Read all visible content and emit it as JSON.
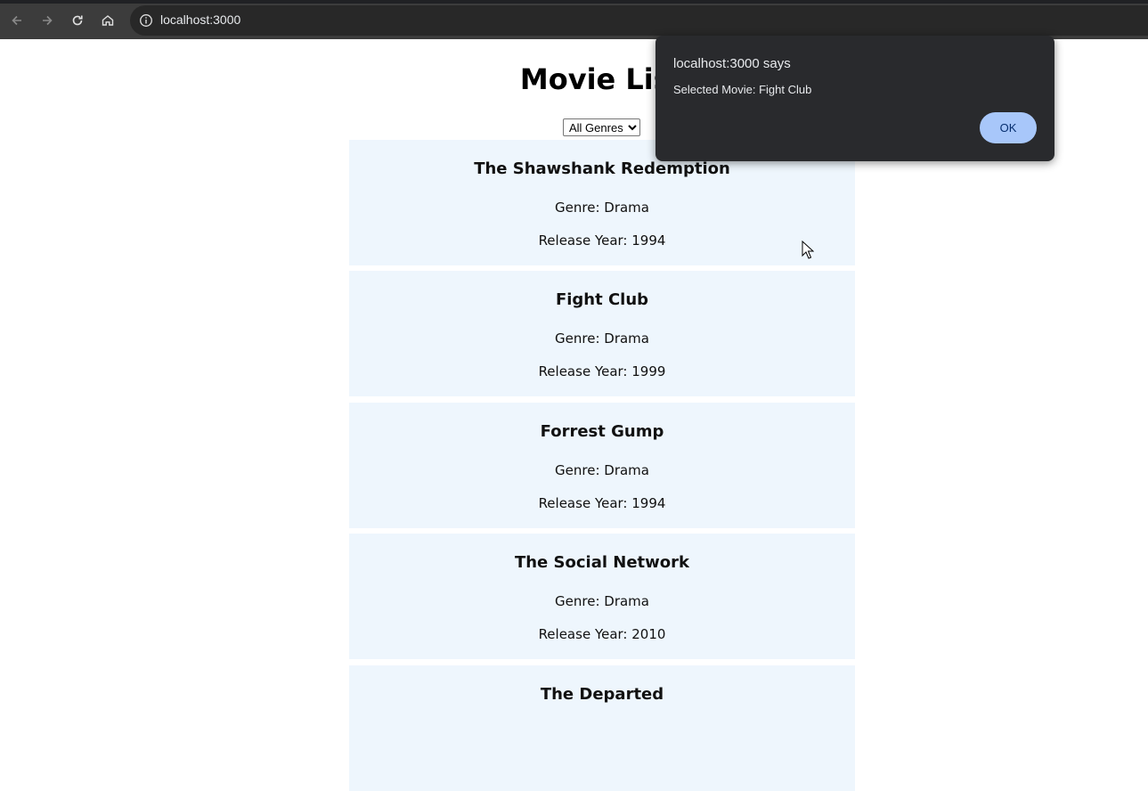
{
  "browser": {
    "url": "localhost:3000",
    "icons": [
      "back-icon",
      "forward-icon",
      "reload-icon",
      "home-icon",
      "info-icon"
    ]
  },
  "page": {
    "title": "Movie List",
    "genre_filter": {
      "selected": "All Genres"
    },
    "movies": [
      {
        "title": "The Shawshank Redemption",
        "genre": "Genre: Drama",
        "year": "Release Year: 1994"
      },
      {
        "title": "Fight Club",
        "genre": "Genre: Drama",
        "year": "Release Year: 1999"
      },
      {
        "title": "Forrest Gump",
        "genre": "Genre: Drama",
        "year": "Release Year: 1994"
      },
      {
        "title": "The Social Network",
        "genre": "Genre: Drama",
        "year": "Release Year: 2010"
      },
      {
        "title": "The Departed",
        "genre": "",
        "year": ""
      }
    ]
  },
  "alert": {
    "origin": "localhost:3000 says",
    "message": "Selected Movie: Fight Club",
    "ok_label": "OK"
  },
  "colors": {
    "card_background": "#eef6fd",
    "dialog_background": "#292a2d",
    "ok_button": "#a8c7fa",
    "browser_chrome": "#3c3c3c"
  }
}
